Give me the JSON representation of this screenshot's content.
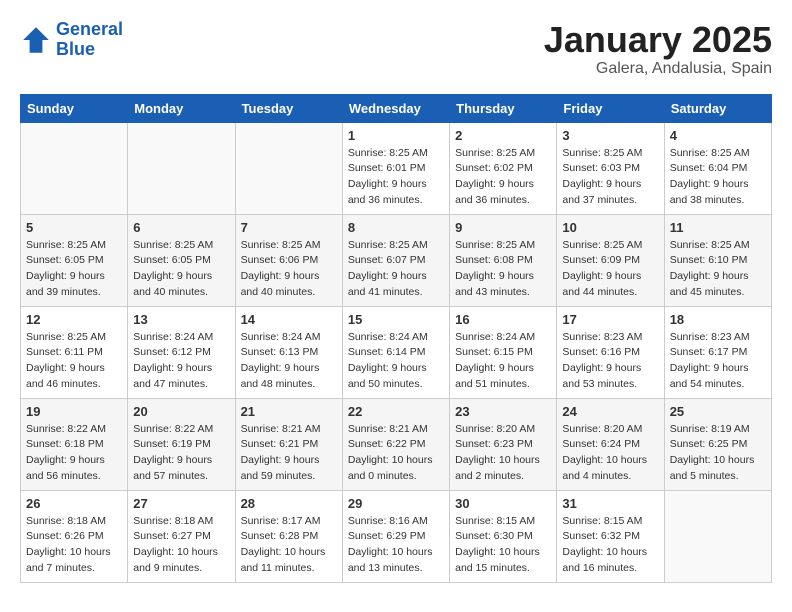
{
  "header": {
    "logo_line1": "General",
    "logo_line2": "Blue",
    "title": "January 2025",
    "subtitle": "Galera, Andalusia, Spain"
  },
  "weekdays": [
    "Sunday",
    "Monday",
    "Tuesday",
    "Wednesday",
    "Thursday",
    "Friday",
    "Saturday"
  ],
  "weeks": [
    [
      {
        "day": "",
        "detail": ""
      },
      {
        "day": "",
        "detail": ""
      },
      {
        "day": "",
        "detail": ""
      },
      {
        "day": "1",
        "detail": "Sunrise: 8:25 AM\nSunset: 6:01 PM\nDaylight: 9 hours and 36 minutes."
      },
      {
        "day": "2",
        "detail": "Sunrise: 8:25 AM\nSunset: 6:02 PM\nDaylight: 9 hours and 36 minutes."
      },
      {
        "day": "3",
        "detail": "Sunrise: 8:25 AM\nSunset: 6:03 PM\nDaylight: 9 hours and 37 minutes."
      },
      {
        "day": "4",
        "detail": "Sunrise: 8:25 AM\nSunset: 6:04 PM\nDaylight: 9 hours and 38 minutes."
      }
    ],
    [
      {
        "day": "5",
        "detail": "Sunrise: 8:25 AM\nSunset: 6:05 PM\nDaylight: 9 hours and 39 minutes."
      },
      {
        "day": "6",
        "detail": "Sunrise: 8:25 AM\nSunset: 6:05 PM\nDaylight: 9 hours and 40 minutes."
      },
      {
        "day": "7",
        "detail": "Sunrise: 8:25 AM\nSunset: 6:06 PM\nDaylight: 9 hours and 40 minutes."
      },
      {
        "day": "8",
        "detail": "Sunrise: 8:25 AM\nSunset: 6:07 PM\nDaylight: 9 hours and 41 minutes."
      },
      {
        "day": "9",
        "detail": "Sunrise: 8:25 AM\nSunset: 6:08 PM\nDaylight: 9 hours and 43 minutes."
      },
      {
        "day": "10",
        "detail": "Sunrise: 8:25 AM\nSunset: 6:09 PM\nDaylight: 9 hours and 44 minutes."
      },
      {
        "day": "11",
        "detail": "Sunrise: 8:25 AM\nSunset: 6:10 PM\nDaylight: 9 hours and 45 minutes."
      }
    ],
    [
      {
        "day": "12",
        "detail": "Sunrise: 8:25 AM\nSunset: 6:11 PM\nDaylight: 9 hours and 46 minutes."
      },
      {
        "day": "13",
        "detail": "Sunrise: 8:24 AM\nSunset: 6:12 PM\nDaylight: 9 hours and 47 minutes."
      },
      {
        "day": "14",
        "detail": "Sunrise: 8:24 AM\nSunset: 6:13 PM\nDaylight: 9 hours and 48 minutes."
      },
      {
        "day": "15",
        "detail": "Sunrise: 8:24 AM\nSunset: 6:14 PM\nDaylight: 9 hours and 50 minutes."
      },
      {
        "day": "16",
        "detail": "Sunrise: 8:24 AM\nSunset: 6:15 PM\nDaylight: 9 hours and 51 minutes."
      },
      {
        "day": "17",
        "detail": "Sunrise: 8:23 AM\nSunset: 6:16 PM\nDaylight: 9 hours and 53 minutes."
      },
      {
        "day": "18",
        "detail": "Sunrise: 8:23 AM\nSunset: 6:17 PM\nDaylight: 9 hours and 54 minutes."
      }
    ],
    [
      {
        "day": "19",
        "detail": "Sunrise: 8:22 AM\nSunset: 6:18 PM\nDaylight: 9 hours and 56 minutes."
      },
      {
        "day": "20",
        "detail": "Sunrise: 8:22 AM\nSunset: 6:19 PM\nDaylight: 9 hours and 57 minutes."
      },
      {
        "day": "21",
        "detail": "Sunrise: 8:21 AM\nSunset: 6:21 PM\nDaylight: 9 hours and 59 minutes."
      },
      {
        "day": "22",
        "detail": "Sunrise: 8:21 AM\nSunset: 6:22 PM\nDaylight: 10 hours and 0 minutes."
      },
      {
        "day": "23",
        "detail": "Sunrise: 8:20 AM\nSunset: 6:23 PM\nDaylight: 10 hours and 2 minutes."
      },
      {
        "day": "24",
        "detail": "Sunrise: 8:20 AM\nSunset: 6:24 PM\nDaylight: 10 hours and 4 minutes."
      },
      {
        "day": "25",
        "detail": "Sunrise: 8:19 AM\nSunset: 6:25 PM\nDaylight: 10 hours and 5 minutes."
      }
    ],
    [
      {
        "day": "26",
        "detail": "Sunrise: 8:18 AM\nSunset: 6:26 PM\nDaylight: 10 hours and 7 minutes."
      },
      {
        "day": "27",
        "detail": "Sunrise: 8:18 AM\nSunset: 6:27 PM\nDaylight: 10 hours and 9 minutes."
      },
      {
        "day": "28",
        "detail": "Sunrise: 8:17 AM\nSunset: 6:28 PM\nDaylight: 10 hours and 11 minutes."
      },
      {
        "day": "29",
        "detail": "Sunrise: 8:16 AM\nSunset: 6:29 PM\nDaylight: 10 hours and 13 minutes."
      },
      {
        "day": "30",
        "detail": "Sunrise: 8:15 AM\nSunset: 6:30 PM\nDaylight: 10 hours and 15 minutes."
      },
      {
        "day": "31",
        "detail": "Sunrise: 8:15 AM\nSunset: 6:32 PM\nDaylight: 10 hours and 16 minutes."
      },
      {
        "day": "",
        "detail": ""
      }
    ]
  ]
}
